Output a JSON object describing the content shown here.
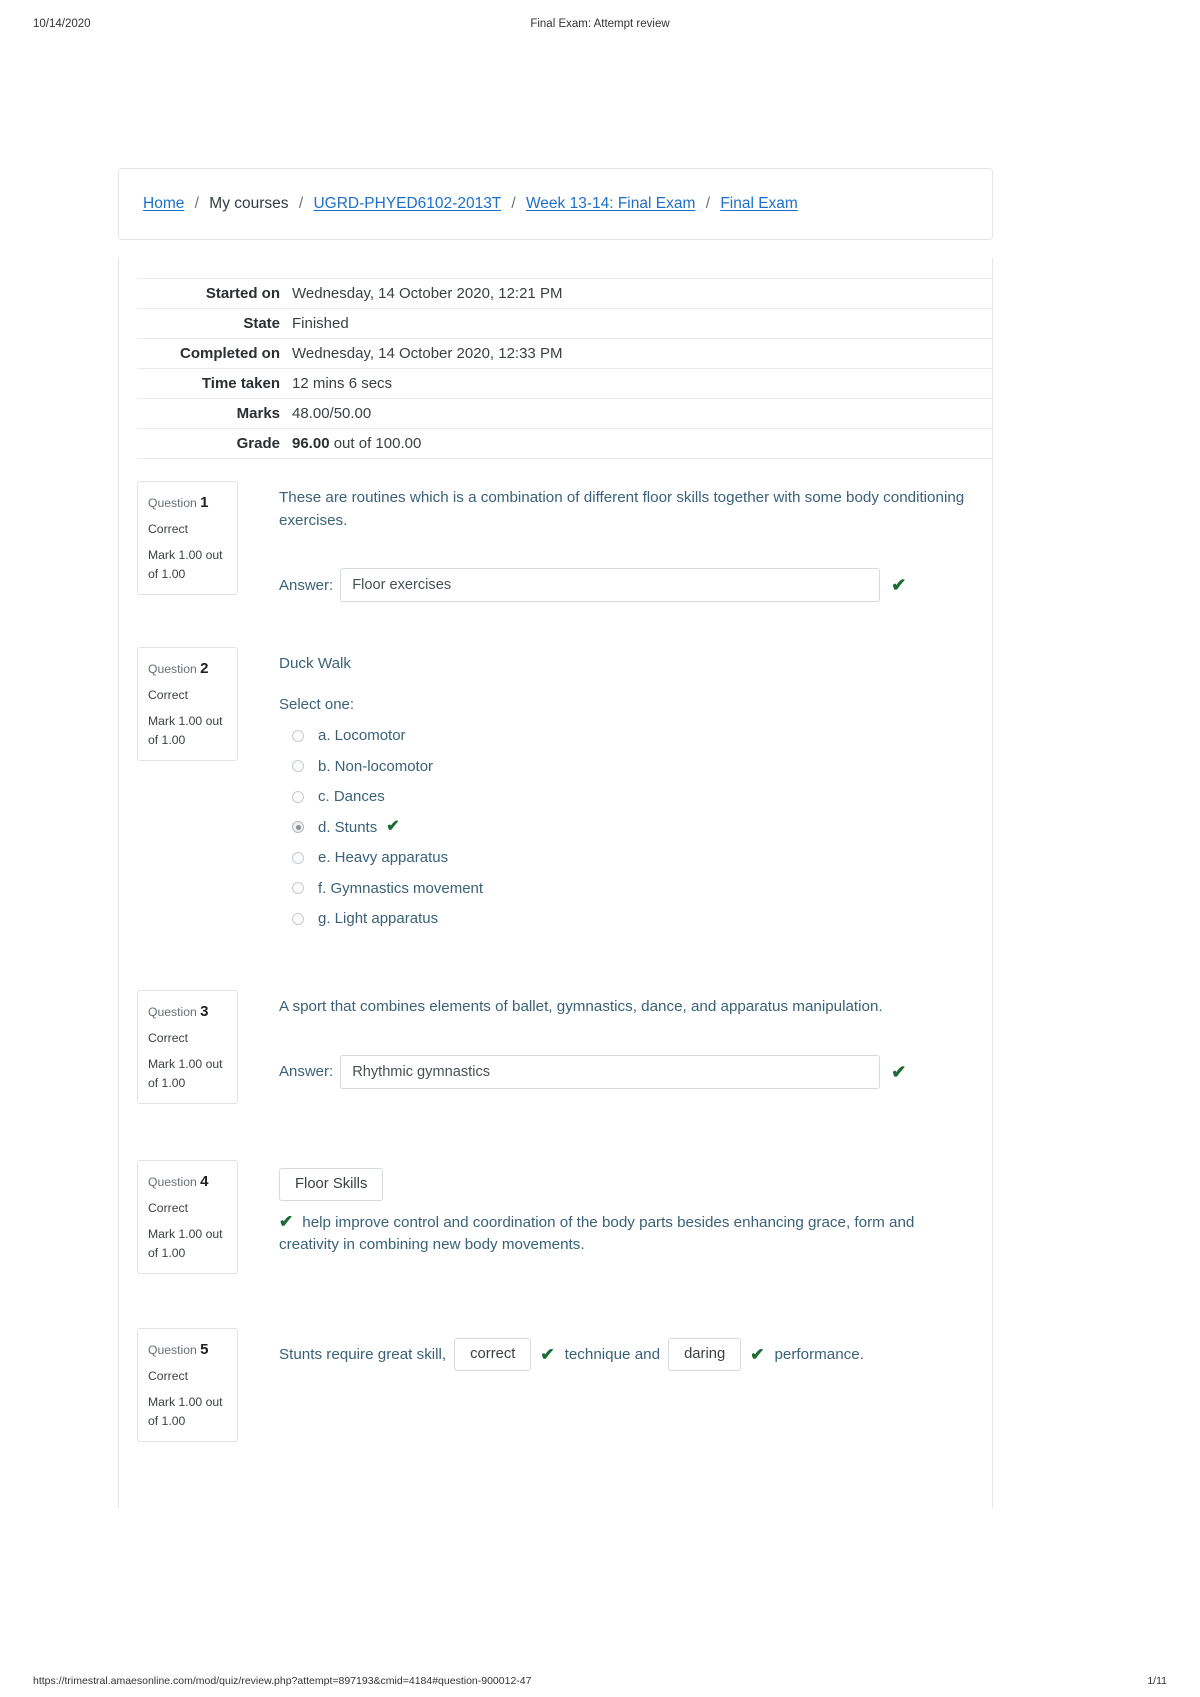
{
  "print_header": {
    "date": "10/14/2020",
    "title": "Final Exam: Attempt review"
  },
  "print_footer": {
    "url": "https://trimestral.amaesonline.com/mod/quiz/review.php?attempt=897193&cmid=4184#question-900012-47",
    "page": "1/11"
  },
  "breadcrumb": {
    "items": [
      {
        "label": "Home",
        "link": true
      },
      {
        "label": "My courses",
        "link": false
      },
      {
        "label": "UGRD-PHYED6102-2013T",
        "link": true
      },
      {
        "label": "Week 13-14: Final Exam",
        "link": true
      },
      {
        "label": "Final Exam",
        "link": true
      }
    ],
    "separator": "/"
  },
  "summary": {
    "rows": [
      {
        "label": "Started on",
        "value": "Wednesday, 14 October 2020, 12:21 PM"
      },
      {
        "label": "State",
        "value": "Finished"
      },
      {
        "label": "Completed on",
        "value": "Wednesday, 14 October 2020, 12:33 PM"
      },
      {
        "label": "Time taken",
        "value": "12 mins 6 secs"
      },
      {
        "label": "Marks",
        "value": "48.00/50.00"
      }
    ],
    "grade": {
      "label": "Grade",
      "value_bold": "96.00",
      "value_rest": " out of 100.00"
    }
  },
  "icons": {
    "correct_tick": "✔"
  },
  "colors": {
    "link": "#1d6fc9",
    "question_text": "#3a6178",
    "correct_green": "#1e6b34",
    "card_border": "#e4e7ea"
  },
  "questions": [
    {
      "info": {
        "question_word": "Question",
        "number": "1",
        "state": "Correct",
        "mark": "Mark 1.00 out of 1.00"
      },
      "type": "shortanswer",
      "text": "These are routines which is a combination of different floor skills together with some body conditioning exercises.",
      "answer_label": "Answer:",
      "answer_value": "Floor exercises",
      "is_correct": true
    },
    {
      "info": {
        "question_word": "Question",
        "number": "2",
        "state": "Correct",
        "mark": "Mark 1.00 out of 1.00"
      },
      "type": "multichoice",
      "text": "Duck Walk",
      "select_label": "Select one:",
      "options": [
        {
          "label": "a. Locomotor",
          "selected": false,
          "correct": false
        },
        {
          "label": "b. Non-locomotor",
          "selected": false,
          "correct": false
        },
        {
          "label": "c. Dances",
          "selected": false,
          "correct": false
        },
        {
          "label": "d. Stunts",
          "selected": true,
          "correct": true
        },
        {
          "label": "e. Heavy apparatus",
          "selected": false,
          "correct": false
        },
        {
          "label": "f. Gymnastics movement",
          "selected": false,
          "correct": false
        },
        {
          "label": "g. Light apparatus",
          "selected": false,
          "correct": false
        }
      ]
    },
    {
      "info": {
        "question_word": "Question",
        "number": "3",
        "state": "Correct",
        "mark": "Mark 1.00 out of 1.00"
      },
      "type": "shortanswer",
      "text": "A sport that combines elements of ballet, gymnastics, dance, and apparatus manipulation.",
      "answer_label": "Answer:",
      "answer_value": "Rhythmic gymnastics",
      "is_correct": true
    },
    {
      "info": {
        "question_word": "Question",
        "number": "4",
        "state": "Correct",
        "mark": "Mark 1.00 out of 1.00"
      },
      "type": "ddwtos",
      "drag_value": "Floor Skills",
      "trailing_text": "help improve control and coordination of the body parts besides enhancing grace, form and creativity in combining new body movements.",
      "is_correct": true
    },
    {
      "info": {
        "question_word": "Question",
        "number": "5",
        "state": "Correct",
        "mark": "Mark 1.00 out of 1.00"
      },
      "type": "ddwtos-inline",
      "segments": {
        "lead": "Stunts require great skill,",
        "gap1": "correct",
        "middle": "technique and",
        "gap2": "daring",
        "tail": "performance."
      },
      "is_correct": true
    }
  ]
}
